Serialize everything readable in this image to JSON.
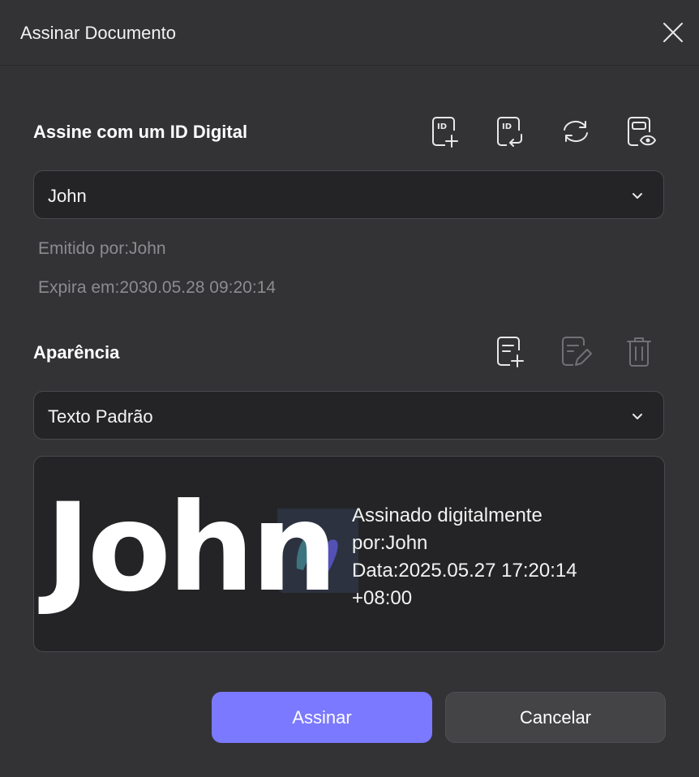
{
  "dialog": {
    "title": "Assinar Documento"
  },
  "digital_id": {
    "heading": "Assine com um ID Digital",
    "selected": "John",
    "issued_by": "Emitido por:John",
    "expires": "Expira em:2030.05.28 09:20:14",
    "toolbar_icons": [
      "id-add-icon",
      "id-import-icon",
      "refresh-icon",
      "id-view-icon"
    ]
  },
  "appearance": {
    "heading": "Aparência",
    "selected": "Texto Padrão",
    "toolbar_icons": [
      "appearance-add-icon",
      "appearance-edit-icon",
      "delete-icon"
    ]
  },
  "preview": {
    "name": "John",
    "lines": [
      "Assinado digitalmente",
      "por:John",
      "Data:2025.05.27 17:20:14",
      "+08:00"
    ]
  },
  "buttons": {
    "sign": "Assinar",
    "cancel": "Cancelar"
  },
  "colors": {
    "background": "#333336",
    "field": "#242426",
    "primary": "#7b79ff",
    "muted_text": "#8c8c90"
  }
}
